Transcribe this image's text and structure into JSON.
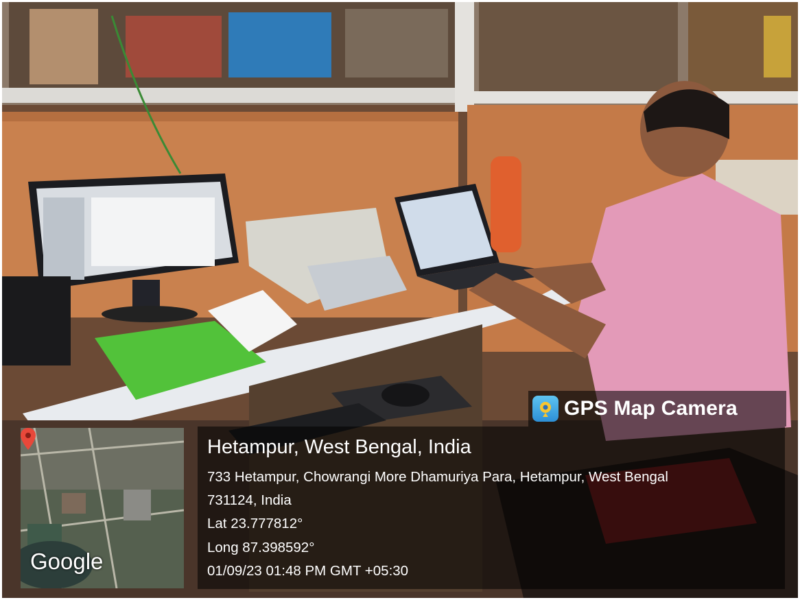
{
  "overlay": {
    "app_name": "GPS Map Camera",
    "location_title": "Hetampur, West Bengal, India",
    "address_line1": "733 Hetampur, Chowrangi More Dhamuriya Para, Hetampur, West Bengal",
    "address_line2": "731124, India",
    "latitude": "Lat 23.777812°",
    "longitude": "Long 87.398592°",
    "datetime": "01/09/23 01:48 PM GMT +05:30",
    "map_logo": "Google",
    "icons": [
      "gps-map-camera-icon",
      "map-pin-icon"
    ],
    "colors": {
      "overlay_bg": "#000000",
      "text": "#ffffff",
      "pin": "#e8483a"
    }
  }
}
